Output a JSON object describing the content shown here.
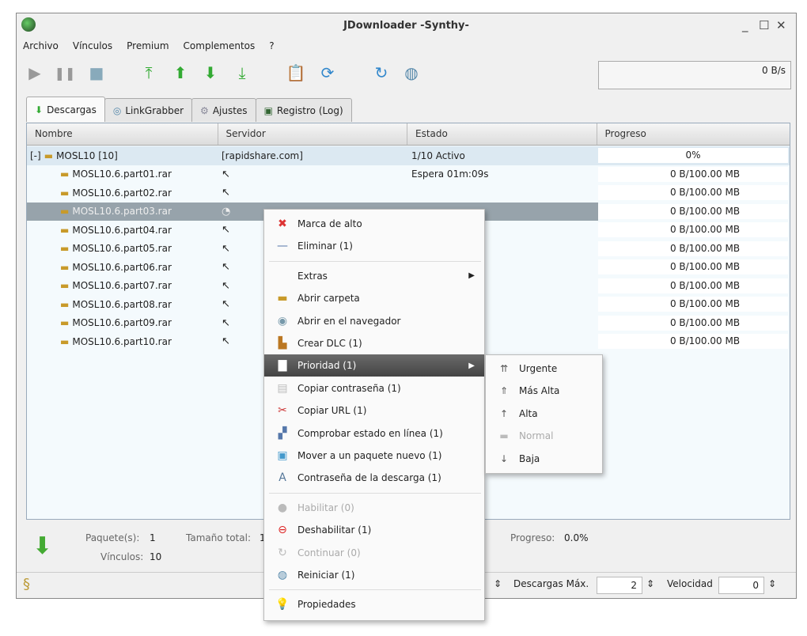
{
  "window": {
    "title": "JDownloader -Synthy-",
    "minimize": "_",
    "maximize": "☐",
    "close": "✕"
  },
  "menu": [
    "Archivo",
    "Vínculos",
    "Premium",
    "Complementos",
    "?"
  ],
  "speed": "0 B/s",
  "tabs": [
    "Descargas",
    "LinkGrabber",
    "Ajustes",
    "Registro (Log)"
  ],
  "columns": [
    "Nombre",
    "Servidor",
    "Estado",
    "Progreso"
  ],
  "package": {
    "name": "MOSL10 [10]",
    "toggle": "[-]",
    "server": "[rapidshare.com]",
    "status": "1/10 Activo",
    "progress": "0%"
  },
  "files": [
    {
      "name": "MOSL10.6.part01.rar",
      "status": "Espera 01m:09s",
      "progress": "0 B/100.00 MB"
    },
    {
      "name": "MOSL10.6.part02.rar",
      "status": "",
      "progress": "0 B/100.00 MB"
    },
    {
      "name": "MOSL10.6.part03.rar",
      "status": "",
      "progress": "0 B/100.00 MB"
    },
    {
      "name": "MOSL10.6.part04.rar",
      "status": "",
      "progress": "0 B/100.00 MB"
    },
    {
      "name": "MOSL10.6.part05.rar",
      "status": "",
      "progress": "0 B/100.00 MB"
    },
    {
      "name": "MOSL10.6.part06.rar",
      "status": "",
      "progress": "0 B/100.00 MB"
    },
    {
      "name": "MOSL10.6.part07.rar",
      "status": "",
      "progress": "0 B/100.00 MB"
    },
    {
      "name": "MOSL10.6.part08.rar",
      "status": "",
      "progress": "0 B/100.00 MB"
    },
    {
      "name": "MOSL10.6.part09.rar",
      "status": "",
      "progress": "0 B/100.00 MB"
    },
    {
      "name": "MOSL10.6.part10.rar",
      "status": "",
      "progress": "0 B/100.00 MB"
    }
  ],
  "info": {
    "packages_label": "Paquete(s):",
    "packages": "1",
    "size_label": "Tamaño total:",
    "size": "1",
    "links_label": "Vínculos:",
    "links": "10",
    "progress_label": "Progreso:",
    "progress": "0.0%"
  },
  "status": {
    "max_label": "Descargas Máx.",
    "max": "2",
    "speed_label": "Velocidad",
    "speed": "0"
  },
  "context_menu": [
    {
      "label": "Marca de alto",
      "icon": "✖",
      "color": "#d33"
    },
    {
      "label": "Eliminar (1)",
      "icon": "—",
      "color": "#57a"
    },
    {
      "sep": true
    },
    {
      "label": "Extras",
      "icon": "",
      "arrow": true
    },
    {
      "label": "Abrir carpeta",
      "icon": "▬",
      "color": "#c89a2a"
    },
    {
      "label": "Abrir en el navegador",
      "icon": "◉",
      "color": "#79a"
    },
    {
      "label": "Crear DLC (1)",
      "icon": "▙",
      "color": "#b72"
    },
    {
      "label": "Prioridad (1)",
      "icon": "▇",
      "color": "#fff",
      "arrow": true,
      "highlight": true
    },
    {
      "label": "Copiar contraseña (1)",
      "icon": "▤",
      "color": "#bbb"
    },
    {
      "label": "Copiar URL (1)",
      "icon": "✂",
      "color": "#c33"
    },
    {
      "label": "Comprobar estado en línea (1)",
      "icon": "▞",
      "color": "#57a"
    },
    {
      "label": "Mover a un paquete nuevo (1)",
      "icon": "▣",
      "color": "#49c"
    },
    {
      "label": "Contraseña de la descarga (1)",
      "icon": "A",
      "color": "#579"
    },
    {
      "sep": true
    },
    {
      "label": "Habilitar (0)",
      "icon": "●",
      "color": "#bbb",
      "disabled": true
    },
    {
      "label": "Deshabilitar (1)",
      "icon": "⊖",
      "color": "#d22"
    },
    {
      "label": "Continuar (0)",
      "icon": "↻",
      "color": "#bbb",
      "disabled": true
    },
    {
      "label": "Reiniciar (1)",
      "icon": "◍",
      "color": "#58a"
    },
    {
      "sep": true
    },
    {
      "label": "Propiedades",
      "icon": "💡",
      "color": "#79a"
    }
  ],
  "priority_menu": [
    {
      "label": "Urgente",
      "icon": "⇈"
    },
    {
      "label": "Más Alta",
      "icon": "⇑"
    },
    {
      "label": "Alta",
      "icon": "↑"
    },
    {
      "label": "Normal",
      "icon": "▬",
      "disabled": true
    },
    {
      "label": "Baja",
      "icon": "↓"
    }
  ]
}
